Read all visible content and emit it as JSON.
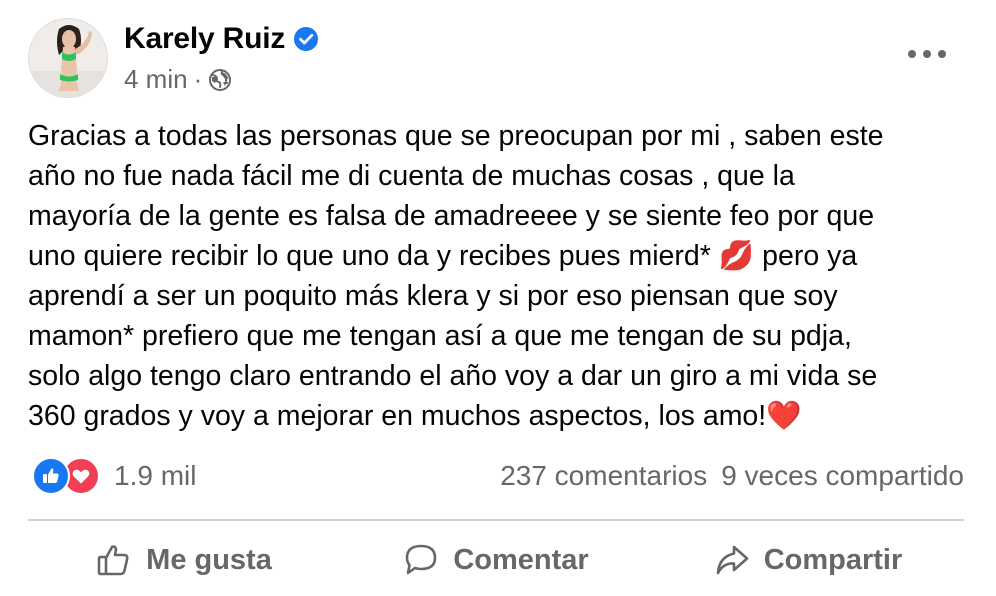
{
  "post": {
    "author": "Karely Ruiz",
    "verified": true,
    "time": "4 min",
    "separator": "·",
    "audience_icon": "globe-icon",
    "menu_icon": "more-options-icon",
    "text": "Gracias a todas las personas que se preocupan por mi , saben este\naño no fue nada fácil me di cuenta de muchas cosas , que la\nmayoría de la gente es falsa de amadreeee y se siente feo por que\nuno quiere recibir lo que uno da y recibes pues mierd* 💋 pero ya\naprendí a ser un poquito más klera y si por eso piensan que soy\nmamon* prefiero que me tengan así a que me tengan de su pdja,\nsolo algo tengo claro entrando el año voy a dar un giro a mi vida se\n360 grados y voy a mejorar en muchos aspectos, los amo!❤️"
  },
  "stats": {
    "reactions_count": "1.9 mil",
    "comments": "237 comentarios",
    "shares": "9 veces compartido"
  },
  "actions": {
    "like": "Me gusta",
    "comment": "Comentar",
    "share": "Compartir"
  },
  "colors": {
    "like_blue": "#1877f2",
    "love_red": "#f33e58",
    "secondary_text": "#65676b",
    "verified_blue": "#1877f2"
  }
}
